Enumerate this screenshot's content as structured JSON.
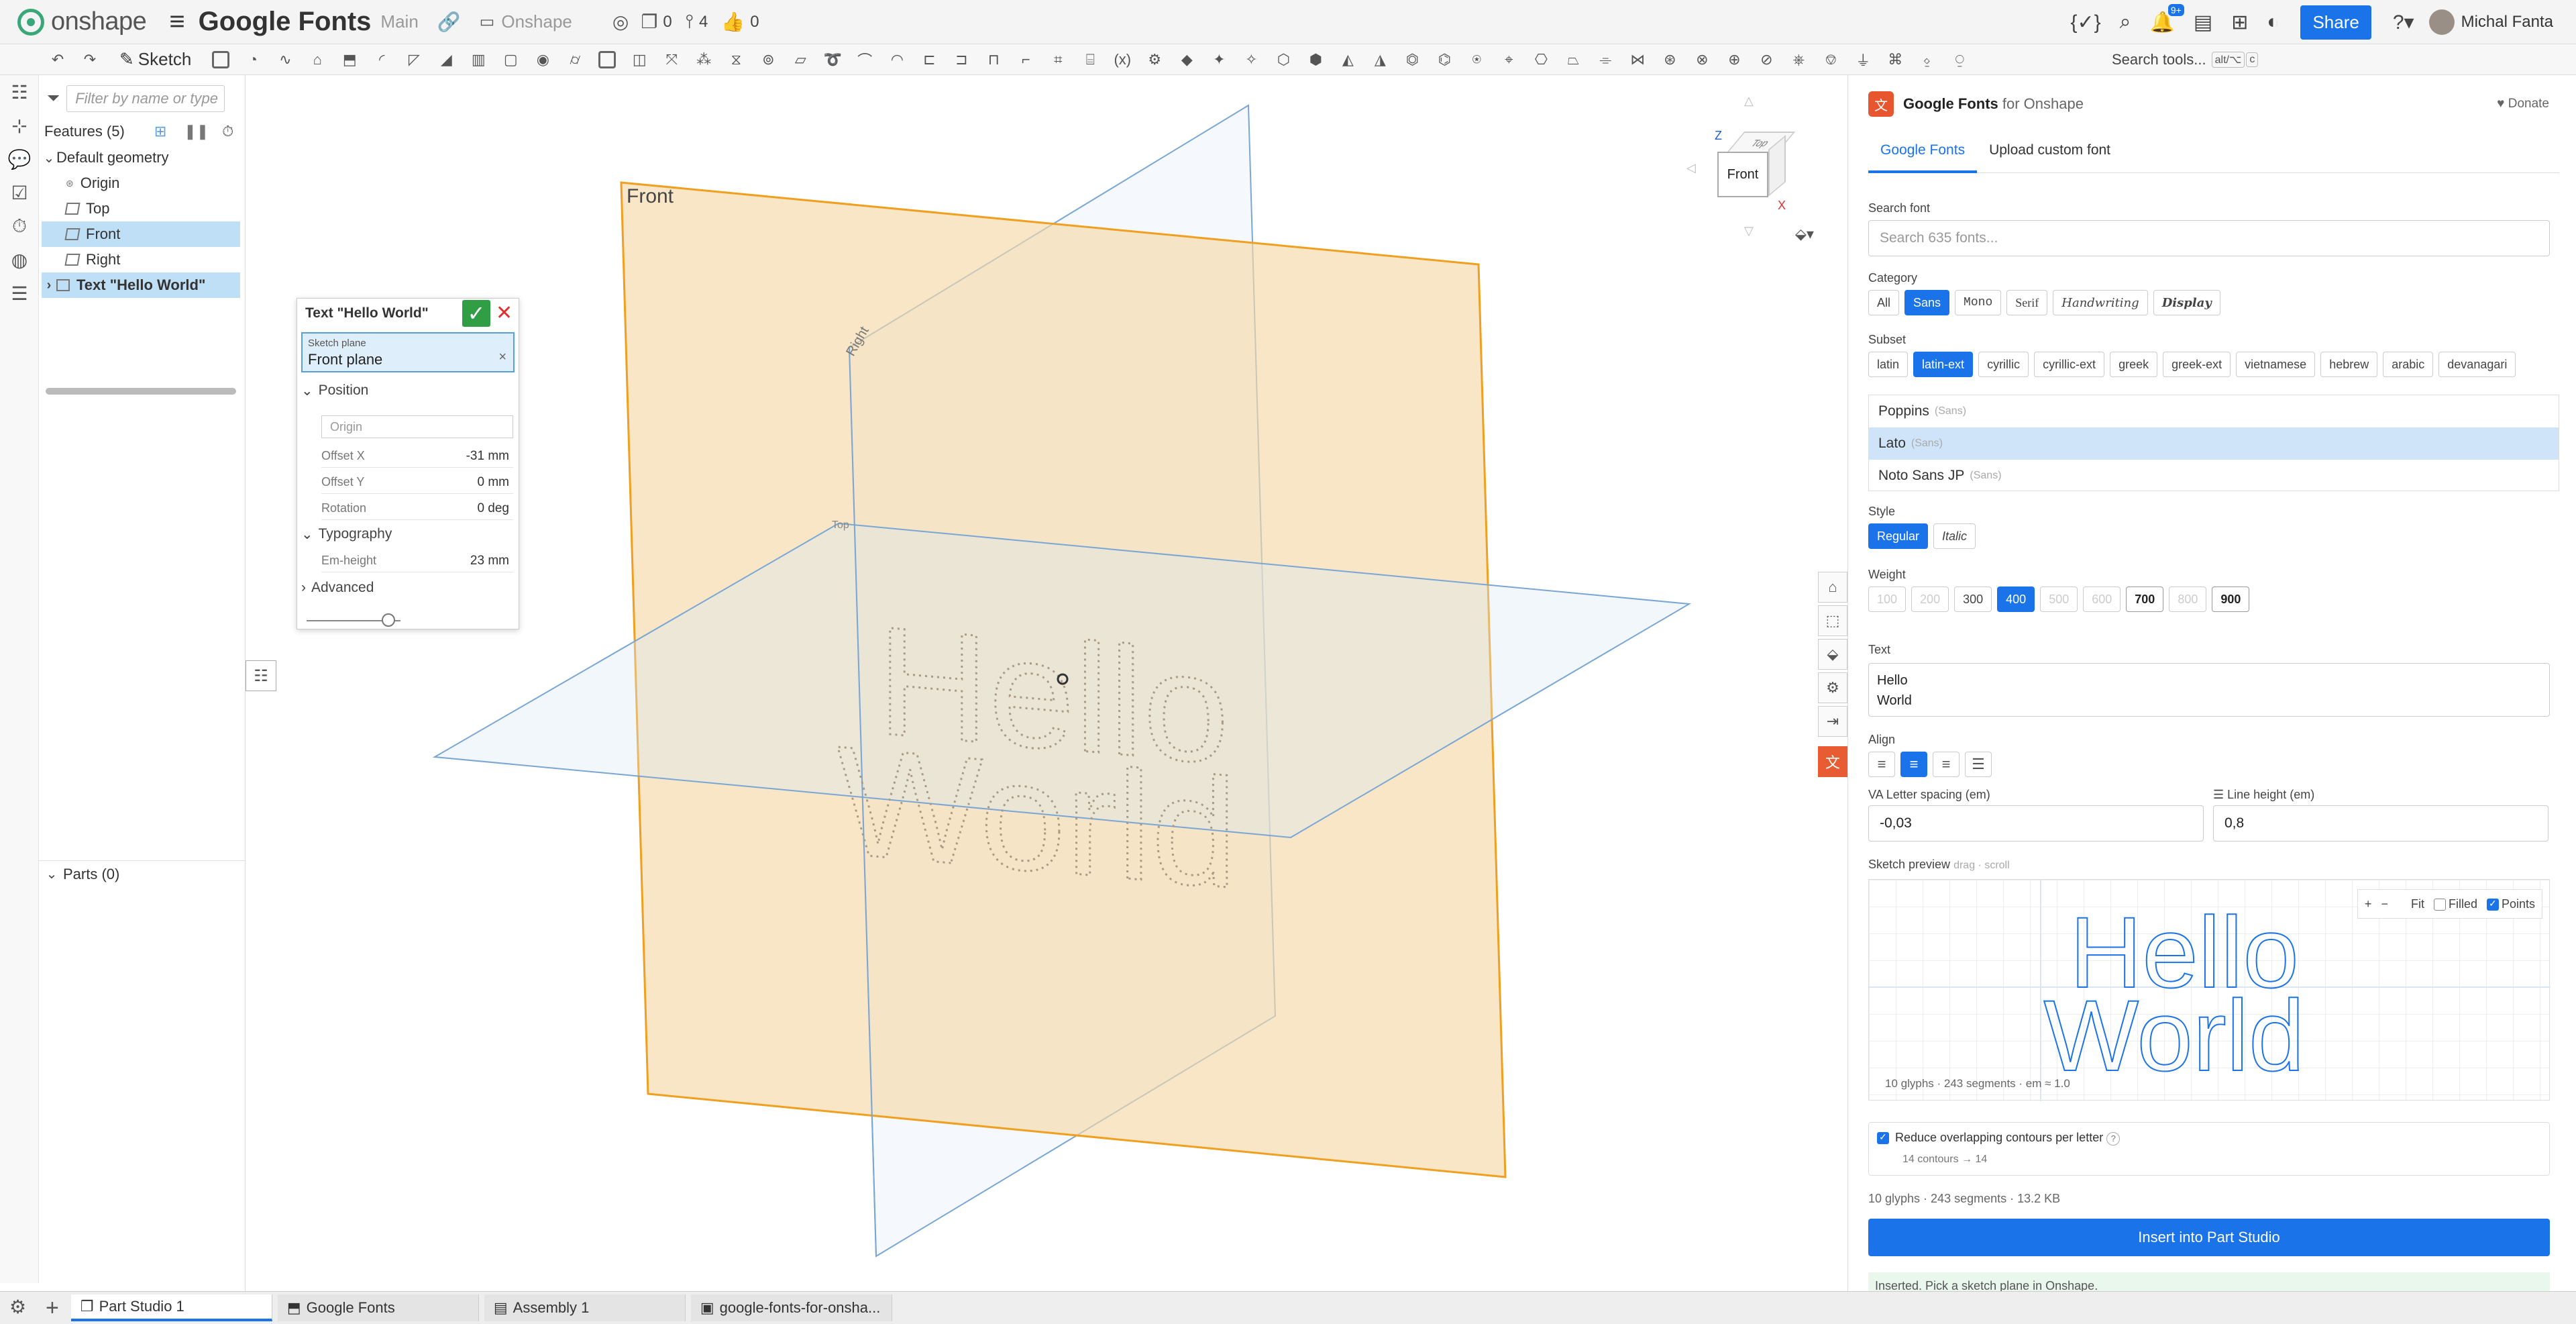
{
  "app": {
    "brand": "onshape",
    "doc_title": "Google Fonts",
    "branch": "Main",
    "folder": "Onshape",
    "counts": {
      "docs": "0",
      "versions": "4",
      "likes": "0"
    },
    "share": "Share",
    "user": "Michal Fanta",
    "notif_badge": "9+"
  },
  "toolbar": {
    "sketch": "Sketch",
    "search_tools": "Search tools...",
    "search_kbd": "alt/⌥",
    "search_kbd2": "c"
  },
  "features": {
    "filter_placeholder": "Filter by name or type",
    "header": "Features (5)",
    "items": [
      {
        "label": "Default geometry"
      },
      {
        "label": "Origin"
      },
      {
        "label": "Top"
      },
      {
        "label": "Front"
      },
      {
        "label": "Right"
      },
      {
        "label": "Text \"Hello World\""
      }
    ],
    "parts": "Parts (0)"
  },
  "dialog": {
    "title": "Text \"Hello World\"",
    "sketch_plane_label": "Sketch plane",
    "sketch_plane_value": "Front plane",
    "position": "Position",
    "origin_placeholder": "Origin",
    "offset_x_label": "Offset X",
    "offset_x": "-31 mm",
    "offset_y_label": "Offset Y",
    "offset_y": "0 mm",
    "rotation_label": "Rotation",
    "rotation": "0 deg",
    "typography": "Typography",
    "em_height_label": "Em-height",
    "em_height": "23 mm",
    "advanced": "Advanced"
  },
  "viewport": {
    "plane_front": "Front",
    "plane_right": "Right",
    "plane_top": "Top",
    "text_line1": "Hello",
    "text_line2": "World"
  },
  "viewcube": {
    "front": "Front",
    "top": "Top",
    "z": "Z",
    "x": "X"
  },
  "panel": {
    "title_bold": "Google Fonts",
    "title_rest": "for Onshape",
    "donate": "Donate",
    "tabs": [
      "Google Fonts",
      "Upload custom font"
    ],
    "search_label": "Search font",
    "search_placeholder": "Search 635 fonts...",
    "category_label": "Category",
    "categories": [
      "All",
      "Sans",
      "Mono",
      "Serif",
      "Handwriting",
      "Display"
    ],
    "subset_label": "Subset",
    "subsets": [
      "latin",
      "latin-ext",
      "cyrillic",
      "cyrillic-ext",
      "greek",
      "greek-ext",
      "vietnamese",
      "hebrew",
      "arabic",
      "devanagari"
    ],
    "fonts": [
      {
        "name": "Poppins",
        "cat": "(Sans)"
      },
      {
        "name": "Lato",
        "cat": "(Sans)"
      },
      {
        "name": "Noto Sans JP",
        "cat": "(Sans)"
      }
    ],
    "style_label": "Style",
    "styles": [
      "Regular",
      "Italic"
    ],
    "weight_label": "Weight",
    "weights": [
      "100",
      "200",
      "300",
      "400",
      "500",
      "600",
      "700",
      "800",
      "900"
    ],
    "text_label": "Text",
    "text_value": "Hello\nWorld",
    "align_label": "Align",
    "letter_spacing_label": "Letter spacing (em)",
    "letter_spacing": "-0,03",
    "line_height_label": "Line height (em)",
    "line_height": "0,8",
    "preview_label": "Sketch preview",
    "preview_hint": "drag · scroll",
    "preview_plus": "+",
    "preview_minus": "−",
    "preview_fit": "Fit",
    "preview_filled": "Filled",
    "preview_points": "Points",
    "preview_line1": "Hello",
    "preview_line2": "World",
    "preview_stats": "10 glyphs · 243 segments · em ≈ 1.0",
    "reduce_label": "Reduce overlapping contours per letter",
    "reduce_hint": "?",
    "reduce_detail": "14 contours → 14",
    "summary": "10 glyphs · 243 segments · 13.2 KB",
    "insert": "Insert into Part Studio",
    "inserted": "Inserted. Pick a sketch plane in Onshape."
  },
  "bottom_tabs": [
    "Part Studio 1",
    "Google Fonts",
    "Assembly 1",
    "google-fonts-for-onsha..."
  ]
}
